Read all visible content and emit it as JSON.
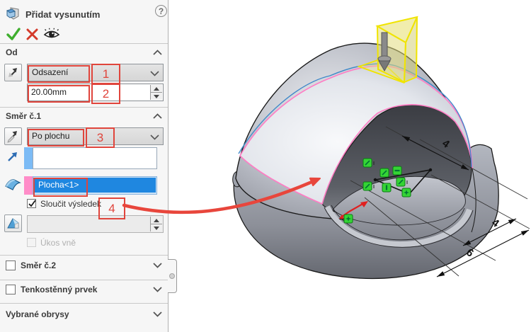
{
  "panel": {
    "title": "Přidat vysunutím",
    "help_glyph": "?",
    "markers": {
      "m1": "1",
      "m2": "2",
      "m3": "3",
      "m4": "4"
    },
    "od": {
      "header": "Od",
      "start_condition": "Odsazení",
      "offset": "20.00mm"
    },
    "dir1": {
      "header": "Směr č.1",
      "end_condition": "Po plochu",
      "direction_selection": "",
      "face_selection": "Plocha<1>",
      "merge_result": "Sloučit výsledek",
      "draft_value": "",
      "draft_outward": "Úkos vně"
    },
    "dir2": {
      "header": "Směr č.2"
    },
    "thin_feature": {
      "header": "Tenkostěnný prvek"
    },
    "selected_contours": {
      "header": "Vybrané obrysy"
    }
  },
  "viewport": {
    "dim_top": "4",
    "dim_right": "4",
    "dim_bottom": "6"
  },
  "colors": {
    "callout_red": "#E0453C",
    "selection_blue": "#1F87E0",
    "swatch_pink": "#FF8CC8",
    "swatch_blue": "#7CBBF5",
    "relation_green": "#35D435",
    "preview_yellow": "#F0E400",
    "edge_pink": "#FF7CC4",
    "edge_blue": "#3F88C9"
  }
}
